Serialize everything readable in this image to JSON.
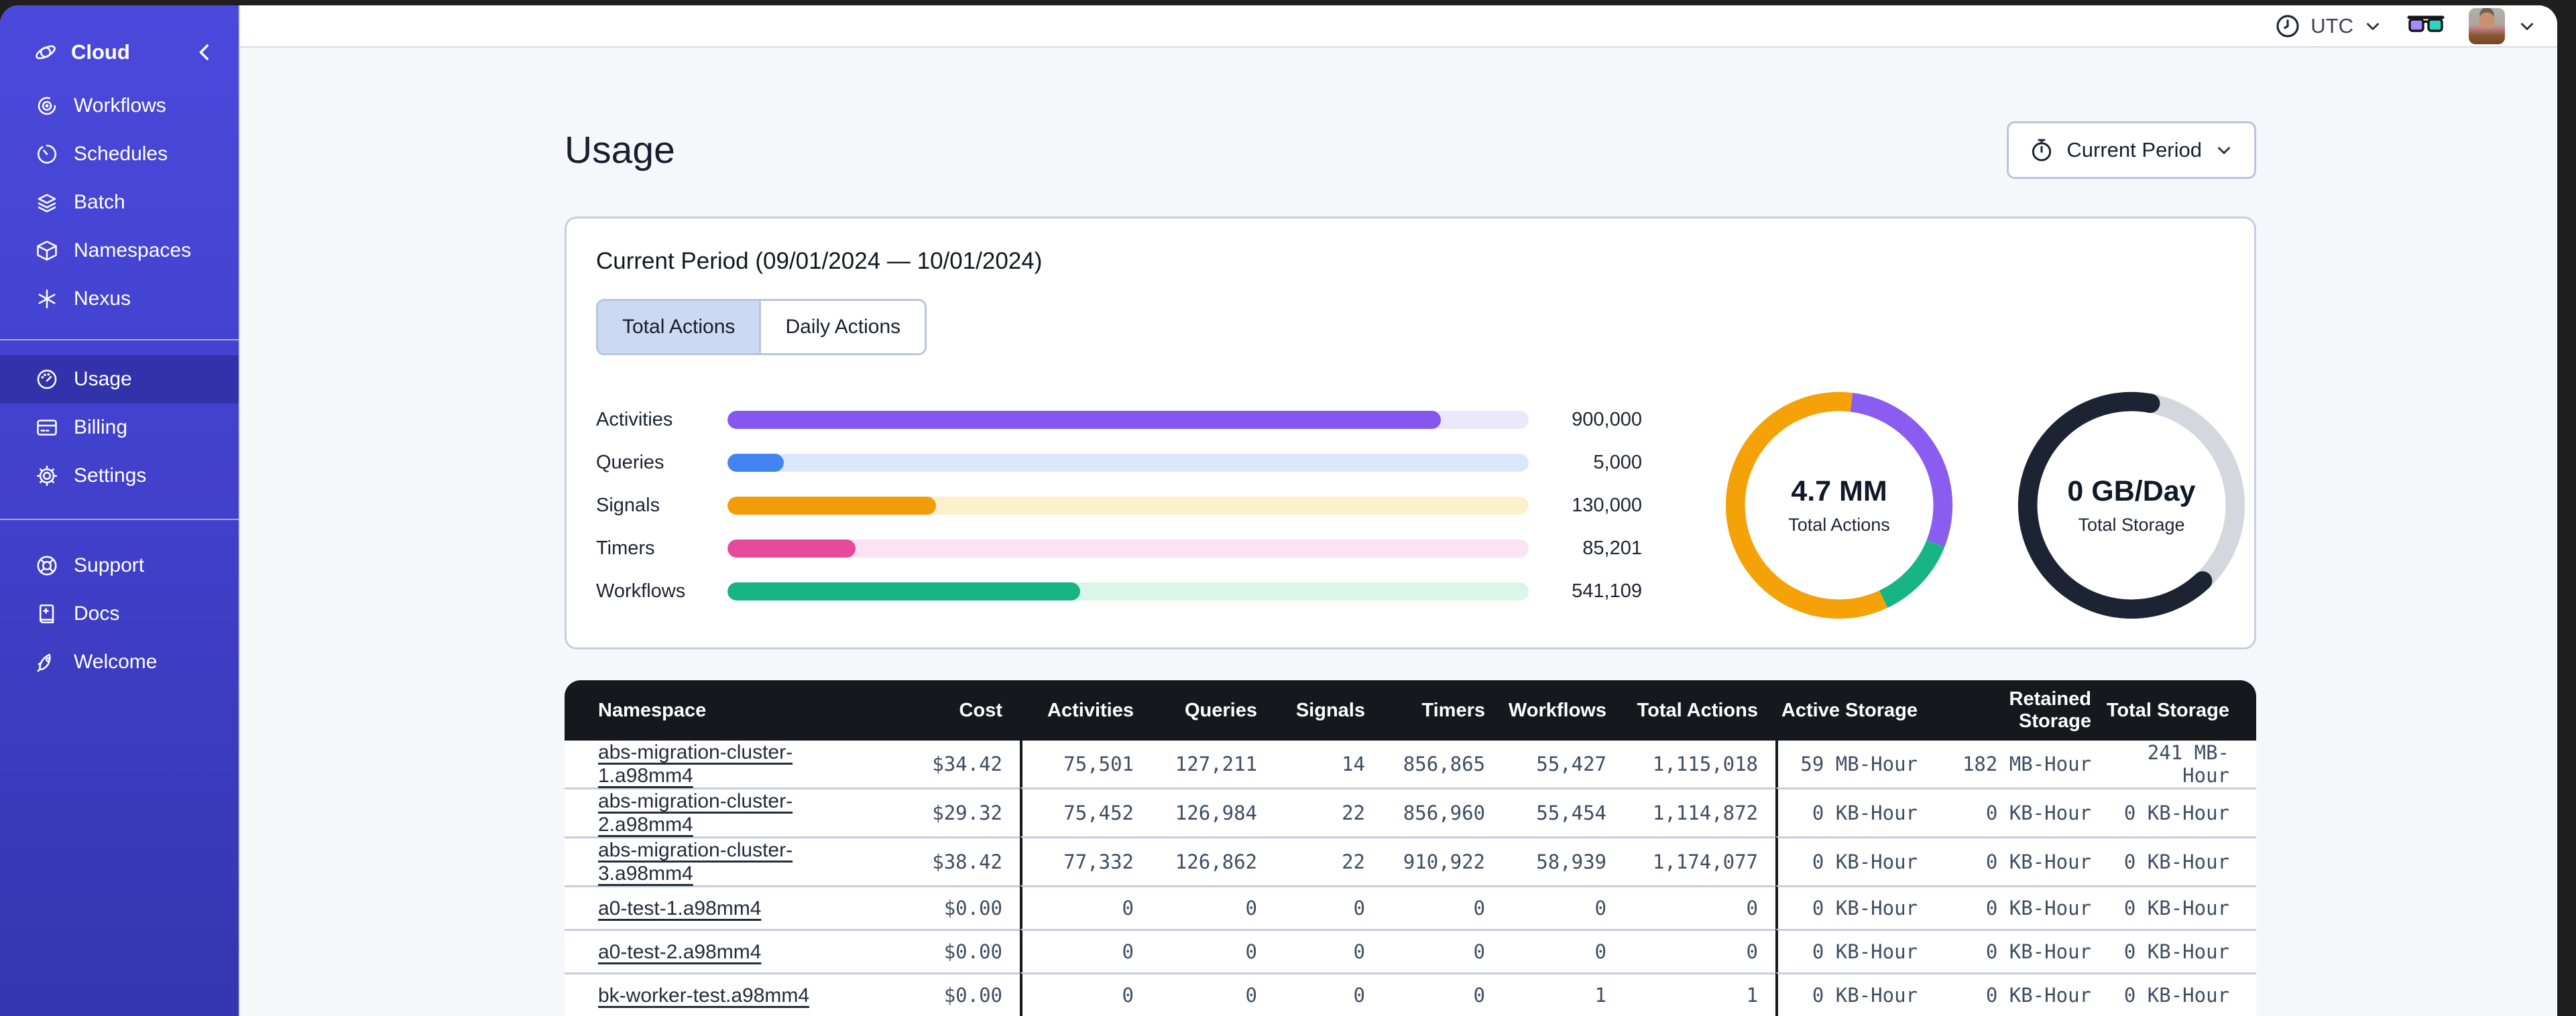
{
  "sidebar": {
    "brand": {
      "label": "Cloud"
    },
    "nav_main": [
      {
        "label": "Workflows"
      },
      {
        "label": "Schedules"
      },
      {
        "label": "Batch"
      },
      {
        "label": "Namespaces"
      },
      {
        "label": "Nexus"
      }
    ],
    "nav_account": [
      {
        "label": "Usage",
        "active": true
      },
      {
        "label": "Billing",
        "active": false
      },
      {
        "label": "Settings",
        "active": false
      }
    ],
    "nav_help": [
      {
        "label": "Support"
      },
      {
        "label": "Docs"
      },
      {
        "label": "Welcome"
      }
    ]
  },
  "topbar": {
    "timezone": "UTC"
  },
  "page": {
    "title": "Usage",
    "period_selector": "Current Period"
  },
  "usage_card": {
    "title": "Current Period (09/01/2024 — 10/01/2024)",
    "tabs": [
      {
        "label": "Total Actions",
        "active": true
      },
      {
        "label": "Daily Actions",
        "active": false
      }
    ],
    "chart_data": {
      "type": "bar",
      "orientation": "horizontal",
      "bars": [
        {
          "label": "Activities",
          "value": 900000,
          "value_label": "900,000",
          "fill_pct": 89,
          "color": "#8458EE",
          "track_color": "#EDE7FC"
        },
        {
          "label": "Queries",
          "value": 5000,
          "value_label": "5,000",
          "fill_pct": 7,
          "color": "#4285F2",
          "track_color": "#DBE7FA"
        },
        {
          "label": "Signals",
          "value": 130000,
          "value_label": "130,000",
          "fill_pct": 26,
          "color": "#F29D08",
          "track_color": "#FCF1CC"
        },
        {
          "label": "Timers",
          "value": 85201,
          "value_label": "85,201",
          "fill_pct": 16,
          "color": "#E84A9B",
          "track_color": "#FBE3F3"
        },
        {
          "label": "Workflows",
          "value": 541109,
          "value_label": "541,109",
          "fill_pct": 44,
          "color": "#17B583",
          "track_color": "#D9F6E8"
        }
      ]
    },
    "donuts": [
      {
        "type": "donut",
        "center_value": "4.7 MM",
        "center_label": "Total Actions",
        "segments": [
          {
            "name": "activities",
            "color": "#8A5CF0",
            "start": 2,
            "pct": 29
          },
          {
            "name": "workflows",
            "color": "#17B583",
            "start": 31,
            "pct": 12
          },
          {
            "name": "signals",
            "color": "#F5A208",
            "start": 43,
            "pct": 59
          }
        ]
      },
      {
        "type": "donut",
        "center_value": "0 GB/Day",
        "center_label": "Total Storage",
        "segments": [
          {
            "name": "free",
            "color": "#D4D7DD",
            "start": 3,
            "pct": 35
          },
          {
            "name": "used",
            "color": "#1C2433",
            "start": 38,
            "pct": 65,
            "cap": "round"
          }
        ]
      }
    ]
  },
  "table": {
    "columns": [
      "Namespace",
      "Cost",
      "Activities",
      "Queries",
      "Signals",
      "Timers",
      "Workflows",
      "Total Actions",
      "Active Storage",
      "Retained Storage",
      "Total Storage"
    ],
    "rows": [
      {
        "cells": [
          "abs-migration-cluster-1.a98mm4",
          "$34.42",
          "75,501",
          "127,211",
          "14",
          "856,865",
          "55,427",
          "1,115,018",
          "59 MB-Hour",
          "182 MB-Hour",
          "241 MB-Hour"
        ]
      },
      {
        "cells": [
          "abs-migration-cluster-2.a98mm4",
          "$29.32",
          "75,452",
          "126,984",
          "22",
          "856,960",
          "55,454",
          "1,114,872",
          "0 KB-Hour",
          "0 KB-Hour",
          "0 KB-Hour"
        ]
      },
      {
        "cells": [
          "abs-migration-cluster-3.a98mm4",
          "$38.42",
          "77,332",
          "126,862",
          "22",
          "910,922",
          "58,939",
          "1,174,077",
          "0 KB-Hour",
          "0 KB-Hour",
          "0 KB-Hour"
        ]
      },
      {
        "cells": [
          "a0-test-1.a98mm4",
          "$0.00",
          "0",
          "0",
          "0",
          "0",
          "0",
          "0",
          "0 KB-Hour",
          "0 KB-Hour",
          "0 KB-Hour"
        ]
      },
      {
        "cells": [
          "a0-test-2.a98mm4",
          "$0.00",
          "0",
          "0",
          "0",
          "0",
          "0",
          "0",
          "0 KB-Hour",
          "0 KB-Hour",
          "0 KB-Hour"
        ]
      },
      {
        "cells": [
          "bk-worker-test.a98mm4",
          "$0.00",
          "0",
          "0",
          "0",
          "0",
          "1",
          "1",
          "0 KB-Hour",
          "0 KB-Hour",
          "0 KB-Hour"
        ]
      }
    ]
  }
}
